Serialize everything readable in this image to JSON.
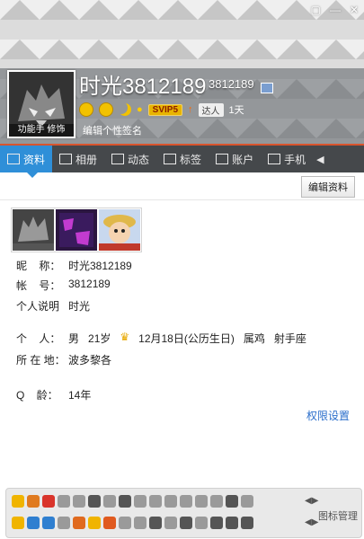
{
  "header": {
    "nickname": "时光3812189",
    "qq_number": "3812189",
    "avatar_label": "功能手 修饰",
    "svip_label": "SVIP5",
    "daren_label": "达人",
    "daren_days": "1天",
    "signature_placeholder": "编辑个性签名"
  },
  "tabs": [
    {
      "label": "资料",
      "icon": "profile-card-icon"
    },
    {
      "label": "相册",
      "icon": "photo-icon"
    },
    {
      "label": "动态",
      "icon": "list-icon"
    },
    {
      "label": "标签",
      "icon": "bookmark-icon"
    },
    {
      "label": "账户",
      "icon": "wallet-icon"
    },
    {
      "label": "手机",
      "icon": "phone-icon"
    }
  ],
  "edit_profile_label": "编辑资料",
  "profile": {
    "nickname_label": "昵    称：",
    "nickname_value": "时光3812189",
    "account_label": "帐    号：",
    "account_value": "3812189",
    "desc_label": "个人说明",
    "desc_value": "时光",
    "person_label": "个    人：",
    "gender": "男",
    "age": "21岁",
    "birthday": "12月18日(公历生日)",
    "zodiac": "属鸡",
    "constellation": "射手座",
    "location_label": "所 在 地：",
    "location_value": "波多黎各",
    "qage_label": "Q    龄：",
    "qage_value": "14年"
  },
  "permission_label": "权限设置",
  "icon_manage_label": "图标管理",
  "colors": {
    "accent": "#2f8fd8",
    "tab_bar": "#45484b",
    "link": "#2a6ecb",
    "orange_line": "#d9542d"
  }
}
